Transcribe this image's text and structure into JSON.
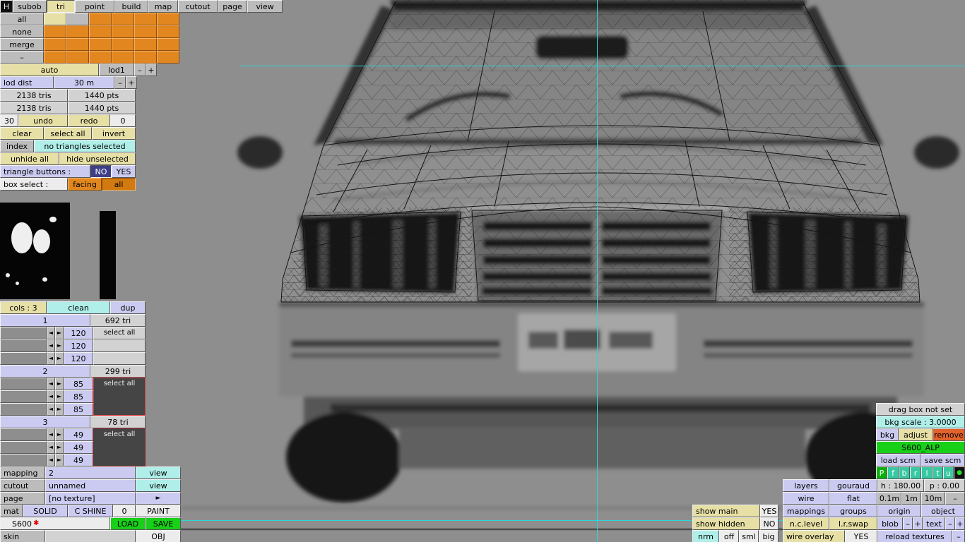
{
  "toolbar": {
    "items": [
      "H",
      "subob",
      "tri",
      "point",
      "build",
      "map",
      "cutout",
      "page",
      "view"
    ]
  },
  "subobject": {
    "buttons": [
      "all",
      "none",
      "merge",
      "–"
    ]
  },
  "lod": {
    "auto": "auto",
    "name": "lod1",
    "minus": "–",
    "plus": "+",
    "dist_label": "lod dist",
    "dist_value": "30 m"
  },
  "stats": {
    "tris": "2138 tris",
    "pts": "1440 pts"
  },
  "history": {
    "undo_count": "30",
    "undo": "undo",
    "redo": "redo",
    "redo_count": "0"
  },
  "selection": {
    "clear": "clear",
    "select_all": "select all",
    "invert": "invert",
    "index": "index",
    "status": "no triangles selected",
    "unhide_all": "unhide all",
    "hide_unselected": "hide unselected",
    "triangle_buttons_label": "triangle buttons :",
    "no": "NO",
    "yes": "YES",
    "box_select_label": "box select :",
    "facing": "facing",
    "all": "all"
  },
  "columns": {
    "cols": "cols : 3",
    "clean": "clean",
    "dup": "dup"
  },
  "arrow_left": "◄",
  "arrow_right": "►",
  "groups": [
    {
      "id": "1",
      "tris": "692 tri",
      "select_all": "select all",
      "values": [
        "120",
        "120",
        "120"
      ]
    },
    {
      "id": "2",
      "tris": "299 tri",
      "select_all": "select all",
      "values": [
        "85",
        "85",
        "85"
      ]
    },
    {
      "id": "3",
      "tris": "78 tri",
      "select_all": "select all",
      "values": [
        "49",
        "49",
        "49"
      ]
    }
  ],
  "mapping": {
    "mapping_label": "mapping",
    "mapping_value": "2",
    "mapping_view": "view",
    "cutout_label": "cutout",
    "cutout_value": "unnamed",
    "cutout_view": "view",
    "page_label": "page",
    "page_value": "[no texture]",
    "page_next": "►",
    "mat_label": "mat",
    "solid": "SOLID",
    "shine": "C SHINE",
    "shine_value": "0",
    "paint": "PAINT",
    "file_name": "S600",
    "file_flag": "✱",
    "load": "LOAD",
    "save": "SAVE",
    "skin": "skin",
    "obj": "OBJ"
  },
  "show": {
    "main_label": "show main",
    "main_value": "YES",
    "hidden_label": "show hidden",
    "hidden_value": "NO",
    "nrm": "nrm",
    "off": "off",
    "sml": "sml",
    "big": "big"
  },
  "display": {
    "layers": "layers",
    "gouraud": "gouraud",
    "heading": "h : 180.00",
    "pitch": "p : 0.00",
    "wire": "wire",
    "flat": "flat",
    "grid_01": "0.1m",
    "grid_1": "1m",
    "grid_10": "10m",
    "dash": "–",
    "mappings": "mappings",
    "groups": "groups",
    "origin": "origin",
    "object": "object",
    "nc_level": "n.c.level",
    "lr_swap": "l.r.swap",
    "blob": "blob",
    "minus": "–",
    "plus": "+",
    "text": "text",
    "wire_overlay": "wire overlay",
    "wire_overlay_value": "YES",
    "reload": "reload textures"
  },
  "background": {
    "drag_box": "drag box not set",
    "scale": "bkg scale : 3.0000",
    "bkg": "bkg",
    "adjust": "adjust",
    "remove": "remove",
    "texture_name": "S600_ALP",
    "load_scm": "load scm",
    "save_scm": "save scm",
    "views": [
      "P",
      "f",
      "b",
      "r",
      "l",
      "t",
      "u",
      "●"
    ]
  }
}
